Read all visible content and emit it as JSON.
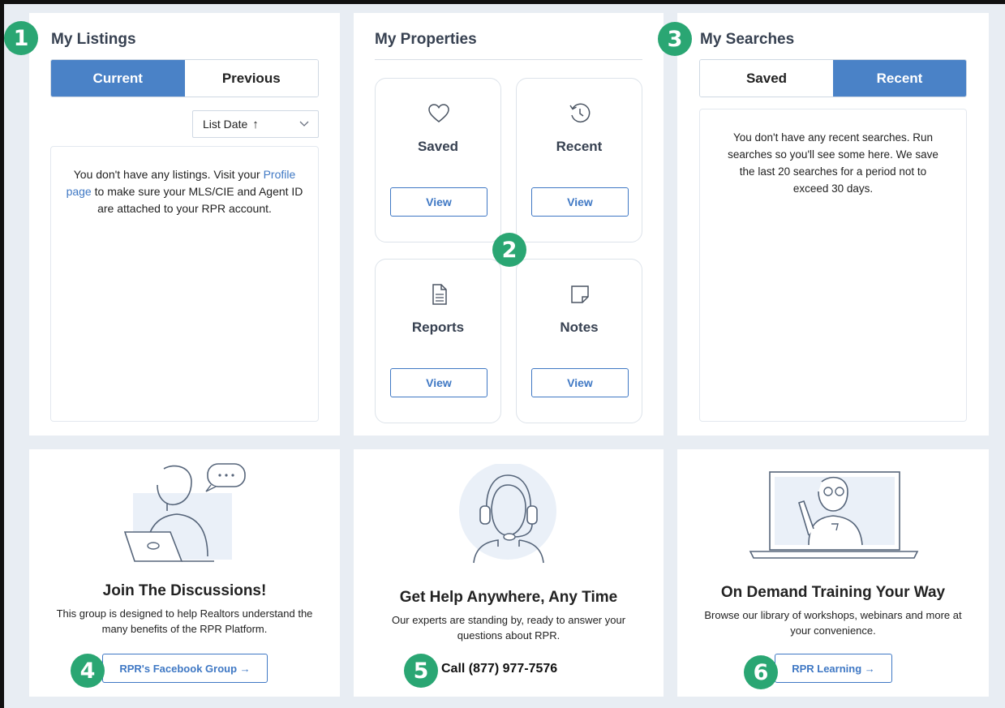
{
  "listings": {
    "title": "My Listings",
    "tabs": [
      "Current",
      "Previous"
    ],
    "active_tab": "Current",
    "sort": {
      "label": "List Date",
      "direction_glyph": "↑"
    },
    "empty": {
      "text_before": "You don't have any listings. Visit your ",
      "link": "Profile page",
      "text_after": " to make sure your MLS/CIE and Agent ID are attached to your RPR account."
    }
  },
  "properties": {
    "title": "My Properties",
    "cards": [
      {
        "label": "Saved",
        "icon": "heart-icon",
        "button": "View"
      },
      {
        "label": "Recent",
        "icon": "history-icon",
        "button": "View"
      },
      {
        "label": "Reports",
        "icon": "document-icon",
        "button": "View"
      },
      {
        "label": "Notes",
        "icon": "note-icon",
        "button": "View"
      }
    ]
  },
  "searches": {
    "title": "My Searches",
    "tabs": [
      "Saved",
      "Recent"
    ],
    "active_tab": "Recent",
    "empty_text": "You don't have any recent searches. Run searches so you'll see some here. We save the last 20 searches for a period not to exceed 30 days."
  },
  "discussions": {
    "title": "Join The Discussions!",
    "description": "This group is designed to help Realtors understand the many benefits of the RPR Platform.",
    "button": "RPR's Facebook Group →"
  },
  "help": {
    "title": "Get Help Anywhere, Any Time",
    "description": "Our experts are standing by, ready to answer your questions about RPR.",
    "call": "Call (877) 977-7576"
  },
  "training": {
    "title": "On Demand Training Your Way",
    "description": "Browse our library of workshops, webinars and more at your convenience.",
    "button": "RPR Learning →"
  },
  "badges": [
    "1",
    "2",
    "3",
    "4",
    "5",
    "6"
  ],
  "colors": {
    "accent": "#4a82c7",
    "badge": "#2aa673",
    "background": "#e8edf3"
  }
}
